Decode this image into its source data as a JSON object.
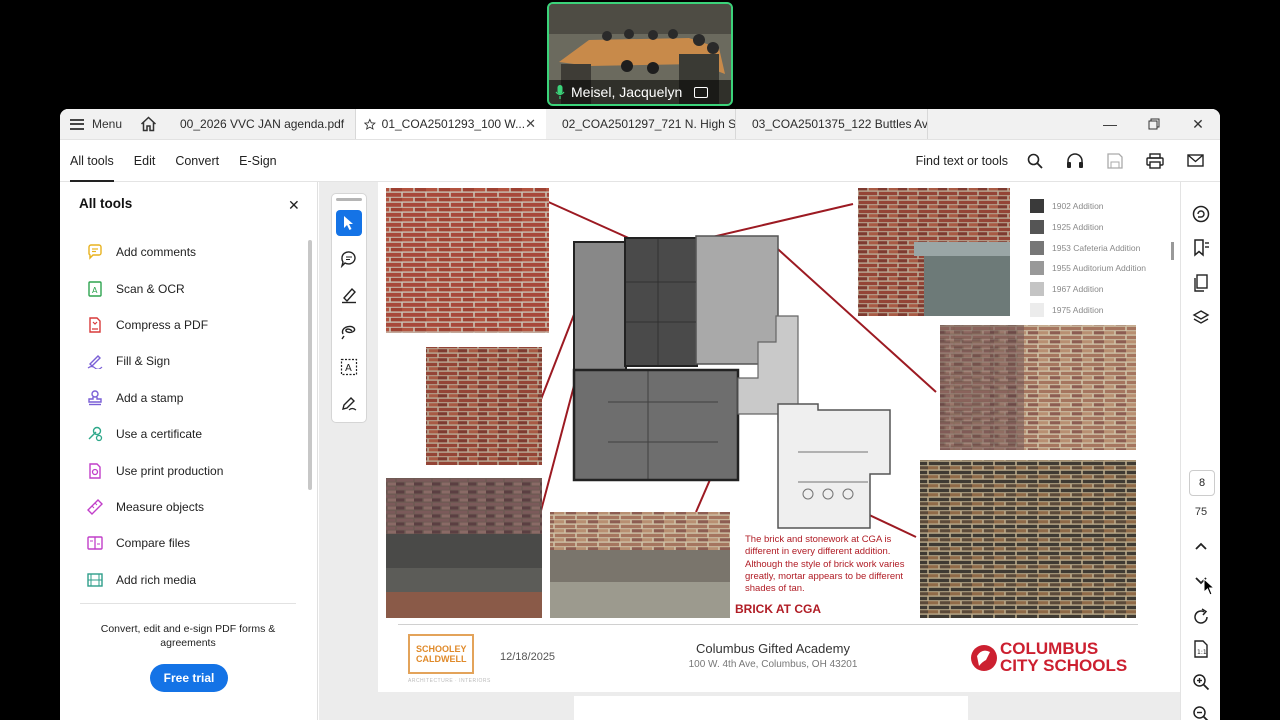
{
  "video": {
    "participant_name": "Meisel, Jacquelyn"
  },
  "titlebar": {
    "menu_label": "Menu",
    "tabs": [
      {
        "label": "00_2026 VVC JAN agenda.pdf"
      },
      {
        "label": "01_COA2501293_100 W..."
      },
      {
        "label": "02_COA2501297_721 N. High St..."
      },
      {
        "label": "03_COA2501375_122 Buttles Av..."
      }
    ]
  },
  "toolbar": {
    "items": [
      "All tools",
      "Edit",
      "Convert",
      "E-Sign"
    ],
    "find_label": "Find text or tools"
  },
  "left_panel": {
    "title": "All tools",
    "items": [
      {
        "label": "Add comments",
        "icon": "comment-icon",
        "color": "#e8b21e"
      },
      {
        "label": "Scan & OCR",
        "icon": "scan-icon",
        "color": "#2ea44f"
      },
      {
        "label": "Compress a PDF",
        "icon": "compress-icon",
        "color": "#d83a3a"
      },
      {
        "label": "Fill & Sign",
        "icon": "fill-sign-icon",
        "color": "#7a5fd6"
      },
      {
        "label": "Add a stamp",
        "icon": "stamp-icon",
        "color": "#7a5fd6"
      },
      {
        "label": "Use a certificate",
        "icon": "certificate-icon",
        "color": "#2ea88a"
      },
      {
        "label": "Use print production",
        "icon": "print-production-icon",
        "color": "#c13fc9"
      },
      {
        "label": "Measure objects",
        "icon": "measure-icon",
        "color": "#c13fc9"
      },
      {
        "label": "Compare files",
        "icon": "compare-icon",
        "color": "#c13fc9"
      },
      {
        "label": "Add rich media",
        "icon": "rich-media-icon",
        "color": "#2e9e8a"
      }
    ],
    "promo_text": "Convert, edit and e-sign PDF forms & agreements",
    "free_trial_label": "Free trial"
  },
  "document": {
    "legend": [
      {
        "label": "1902 Addition",
        "color": "#3a3a3a"
      },
      {
        "label": "1925 Addition",
        "color": "#555555"
      },
      {
        "label": "1953 Cafeteria Addition",
        "color": "#777777"
      },
      {
        "label": "1955 Auditorium Addition",
        "color": "#999999"
      },
      {
        "label": "1967 Addition",
        "color": "#c4c4c4"
      },
      {
        "label": "1975 Addition",
        "color": "#ececec"
      }
    ],
    "caption": "The brick and stonework at CGA is different in every different addition. Although the style of brick work varies greatly, mortar appears to be different shades of tan.",
    "brick_label": "BRICK AT CGA",
    "firm_line1": "SCHOOLEY",
    "firm_line2": "CALDWELL",
    "firm_sub": "ARCHITECTURE · INTERIORS",
    "date": "12/18/2025",
    "school_name": "Columbus Gifted Academy",
    "school_address": "100 W. 4th Ave, Columbus, OH 43201",
    "district_line1": "COLUMBUS",
    "district_line2": "CITY SCHOOLS"
  },
  "navigation": {
    "current_page": "8",
    "total_pages": "75"
  },
  "colors": {
    "accent": "#1473e6",
    "brand_red": "#cc2030",
    "caption_red": "#b01c25"
  }
}
